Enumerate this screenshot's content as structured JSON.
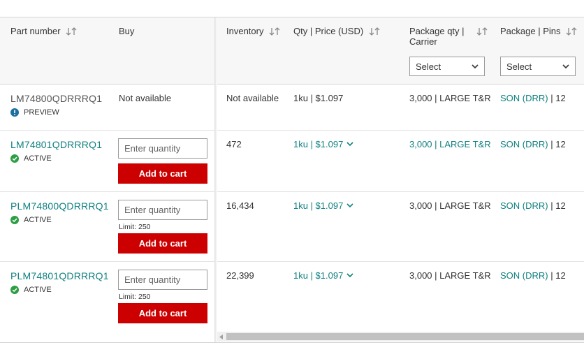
{
  "headers": {
    "part_number": "Part number",
    "buy": "Buy",
    "inventory": "Inventory",
    "qty_price": "Qty | Price (USD)",
    "package_qty_1": "Package qty |",
    "package_qty_2": "Carrier",
    "package_pins": "Package | Pins"
  },
  "filters": {
    "package_qty_select": "Select",
    "package_pins_select": "Select"
  },
  "rows": [
    {
      "part": "LM74800QDRRRQ1",
      "status": "PREVIEW",
      "buy": "Not available",
      "inventory": "Not available",
      "price": "1ku | $1.097",
      "package_qty": "3,000 | LARGE T&R",
      "package": "SON (DRR)",
      "pins": " | 12"
    },
    {
      "part": "LM74801QDRRRQ1",
      "status": "ACTIVE",
      "qty_placeholder": "Enter quantity",
      "cart": "Add to cart",
      "inventory": "472",
      "price": "1ku | $1.097",
      "package_qty": "3,000 | LARGE T&R",
      "package": "SON (DRR)",
      "pins": " | 12"
    },
    {
      "part": "PLM74800QDRRRQ1",
      "status": "ACTIVE",
      "qty_placeholder": "Enter quantity",
      "limit": "Limit: 250",
      "cart": "Add to cart",
      "inventory": "16,434",
      "price": "1ku | $1.097",
      "package_qty": "3,000 | LARGE T&R",
      "package": "SON (DRR)",
      "pins": " | 12"
    },
    {
      "part": "PLM74801QDRRRQ1",
      "status": "ACTIVE",
      "qty_placeholder": "Enter quantity",
      "limit": "Limit: 250",
      "cart": "Add to cart",
      "inventory": "22,399",
      "price": "1ku | $1.097",
      "package_qty": "3,000 | LARGE T&R",
      "package": "SON (DRR)",
      "pins": " | 12"
    }
  ],
  "colors": {
    "link": "#118080",
    "cart": "#cc0000",
    "active": "#2e9e44",
    "preview": "#1a6fa0",
    "header_bg": "#f7f7f7"
  },
  "icons": {
    "sort": "sort-arrows-icon",
    "active": "check-circle-icon",
    "preview": "exclamation-circle-icon",
    "expand": "chevron-down-icon"
  }
}
